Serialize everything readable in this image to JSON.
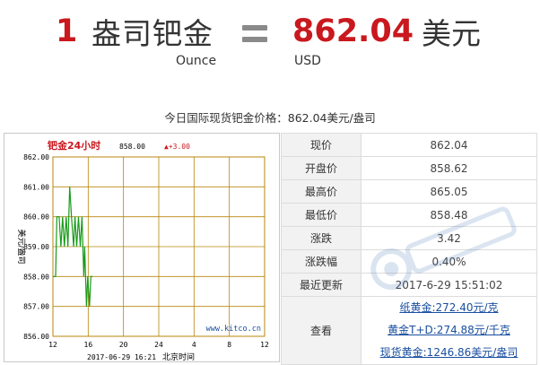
{
  "header": {
    "left_qty": "1",
    "left_unit": "盎司钯金",
    "left_unit_en": "Ounce",
    "right_value": "862.04",
    "right_unit": "美元",
    "right_unit_en": "USD"
  },
  "subtitle": {
    "label": "今日国际现货钯金价格：",
    "price": "862.04",
    "unit": "美元/盎司"
  },
  "chart_data": {
    "type": "line",
    "title": "钯金24小时",
    "price_label": "858.00",
    "change_label": "▲+3.00",
    "source": "www.kitco.cn",
    "timestamp": "2017-06-29 16:21",
    "xlabel": "北京时间",
    "ylabel": "美元/盎司",
    "x_tick_labels": [
      "12",
      "16",
      "20",
      "24",
      "4",
      "8",
      "12"
    ],
    "y_ticks": [
      "862.00",
      "861.00",
      "860.00",
      "859.00",
      "858.00",
      "857.00",
      "856.00"
    ],
    "ylim": [
      856,
      862
    ],
    "xlim": [
      0,
      24
    ],
    "series": [
      {
        "color": "#1a9a1a",
        "x": [
          0,
          0.3,
          0.45,
          0.7,
          0.9,
          1.1,
          1.3,
          1.5,
          1.7,
          1.9,
          2.1,
          2.35,
          2.5,
          2.7,
          2.9,
          3.1,
          3.3,
          3.5,
          3.6,
          3.8,
          3.95,
          4.15,
          4.3,
          4.5
        ],
        "y": [
          858.0,
          858.0,
          860.0,
          860.0,
          859.0,
          860.0,
          859.0,
          860.0,
          859.0,
          861.0,
          860.0,
          859.0,
          860.0,
          859.0,
          860.0,
          859.0,
          860.0,
          858.0,
          859.0,
          857.0,
          858.0,
          857.0,
          858.0,
          858.0
        ]
      }
    ]
  },
  "info_table": {
    "rows": [
      {
        "label": "现价",
        "value": "862.04"
      },
      {
        "label": "开盘价",
        "value": "858.62"
      },
      {
        "label": "最高价",
        "value": "865.05"
      },
      {
        "label": "最低价",
        "value": "858.48"
      },
      {
        "label": "涨跌",
        "value": "3.42"
      },
      {
        "label": "涨跌幅",
        "value": "0.40%"
      },
      {
        "label": "最近更新",
        "value": "2017-6-29 15:51:02"
      }
    ],
    "look_label": "查看",
    "links": [
      "纸黄金:272.40元/克",
      "黄金T+D:274.88元/千克",
      "现货黄金:1246.86美元/盎司"
    ]
  },
  "colors": {
    "accent_red": "#c9181e",
    "link_blue": "#1a4fa0",
    "chart_line": "#1a9a1a",
    "chart_grid": "#b8860b"
  }
}
